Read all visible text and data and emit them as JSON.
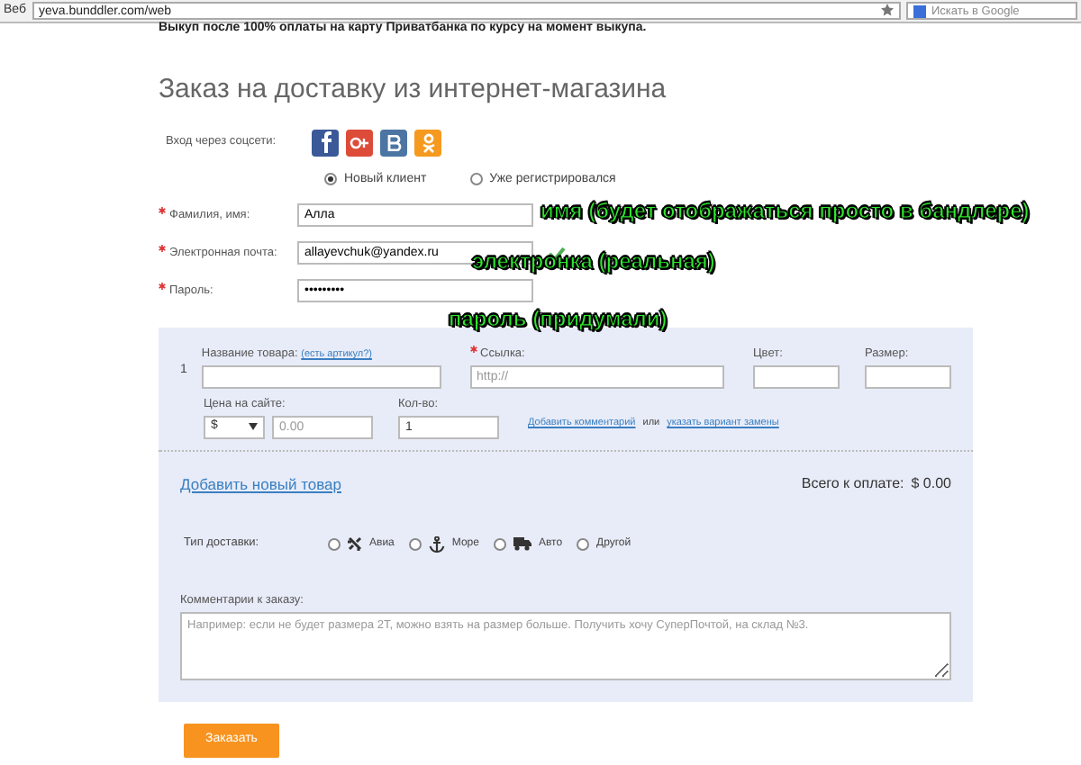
{
  "browser": {
    "tab_label": "Веб",
    "url": "yeva.bunddler.com/web",
    "search_placeholder": "Искать в Google"
  },
  "notice": "Выкуп после 100% оплаты на карту Приватбанка по курсу на момент выкупа.",
  "title": "Заказ на доставку из интернет-магазина",
  "social": {
    "label": "Вход через соцсети:",
    "networks": [
      {
        "kind": "facebook",
        "color": "#3b5998"
      },
      {
        "kind": "googleplus",
        "color": "#dd4b39"
      },
      {
        "kind": "vk",
        "color": "#4c75a3"
      },
      {
        "kind": "ok",
        "color": "#f59a1f"
      }
    ]
  },
  "client_type": [
    {
      "label": "Новый клиент",
      "selected": true
    },
    {
      "label": "Уже регистрировался",
      "selected": false
    }
  ],
  "fields": [
    {
      "label": "Фамилия, имя:",
      "required": true,
      "kind": "text",
      "value": "Алла",
      "valid": false
    },
    {
      "label": "Электронная почта:",
      "required": true,
      "kind": "text",
      "value": "allayevchuk@yandex.ru",
      "valid": true
    },
    {
      "label": "Пароль:",
      "required": true,
      "kind": "password",
      "value": "•••••••••",
      "valid": false
    }
  ],
  "item": {
    "number": "1",
    "name_label": "Название товара:",
    "name_hint": "(есть артикул?)",
    "link_label": "Ссылка:",
    "link_required": true,
    "link_placeholder": "http://",
    "color_label": "Цвет:",
    "size_label": "Размер:",
    "price_label": "Цена на сайте:",
    "currency": "$",
    "price_placeholder": "0.00",
    "qty_label": "Кол-во:",
    "qty_value": "1",
    "comment_link": "Добавить комментарий",
    "or_text": "или",
    "replace_link": "указать вариант замены"
  },
  "add_item": "Добавить новый товар",
  "total": {
    "label": "Всего к оплате:",
    "value": "$ 0.00"
  },
  "delivery": {
    "label": "Тип доставки:",
    "options": [
      {
        "label": "Авиа",
        "kind": "plane",
        "selected": false
      },
      {
        "label": "Море",
        "kind": "anchor",
        "selected": false
      },
      {
        "label": "Авто",
        "kind": "truck",
        "selected": false
      },
      {
        "label": "Другой",
        "kind": "none",
        "selected": false
      }
    ]
  },
  "comment": {
    "label": "Комментарии к заказу:",
    "placeholder": "Например: если не будет размера 2Т, можно взять на размер больше. Получить хочу СуперПочтой, на склад №3."
  },
  "submit": "Заказать",
  "annotations": [
    "имя (будет отображаться просто в бандлере)",
    "электронка (реальная)",
    "пароль (придумали)"
  ]
}
